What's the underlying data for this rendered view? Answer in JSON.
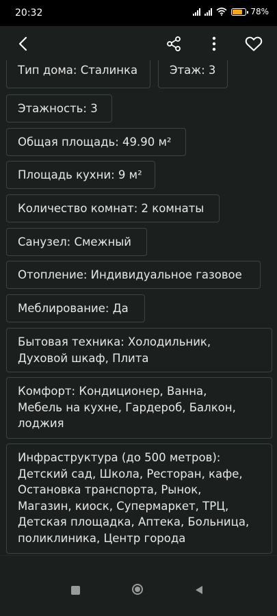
{
  "status": {
    "time": "20:32",
    "battery": "78"
  },
  "toolbar": {
    "back_icon": "back-arrow-icon",
    "share_icon": "share-icon",
    "more_icon": "more-vertical-icon",
    "favorite_icon": "heart-icon"
  },
  "details": {
    "house_type": "Тип дома: Сталинка",
    "floor": "Этаж: 3",
    "floors_total": "Этажность: 3",
    "total_area": "Общая площадь: 49.90 м²",
    "kitchen_area": "Площадь кухни: 9 м²",
    "rooms": "Количество комнат: 2 комнаты",
    "bathroom": "Санузел: Смежный",
    "heating": "Отопление: Индивидуальное газовое",
    "furnished": "Меблирование: Да",
    "appliances_1": "Бытовая техника: Холодильник,",
    "appliances_2": "Духовой шкаф, Плита",
    "comfort_1": "Комфорт: Кондиционер, Ванна,",
    "comfort_2": "Мебель на кухне, Гардероб, Балкон,",
    "comfort_3": "лоджия",
    "infra_1": "Инфраструктура (до 500 метров):",
    "infra_2": "Детский сад, Школа, Ресторан, кафе,",
    "infra_3": "Остановка транспорта, Рынок,",
    "infra_4": "Магазин, киоск, Супермаркет, ТРЦ,",
    "infra_5": "Детская площадка, Аптека, Больница,",
    "infra_6": "поликлиника, Центр города"
  },
  "navbar": {
    "recents_icon": "square-recents-icon",
    "home_icon": "circle-home-icon",
    "back_icon": "triangle-back-icon"
  },
  "colors": {
    "background": "#1b1f1e",
    "chip_border": "#3c4443",
    "text": "#e8e8e8",
    "battery": "#f5a623"
  }
}
